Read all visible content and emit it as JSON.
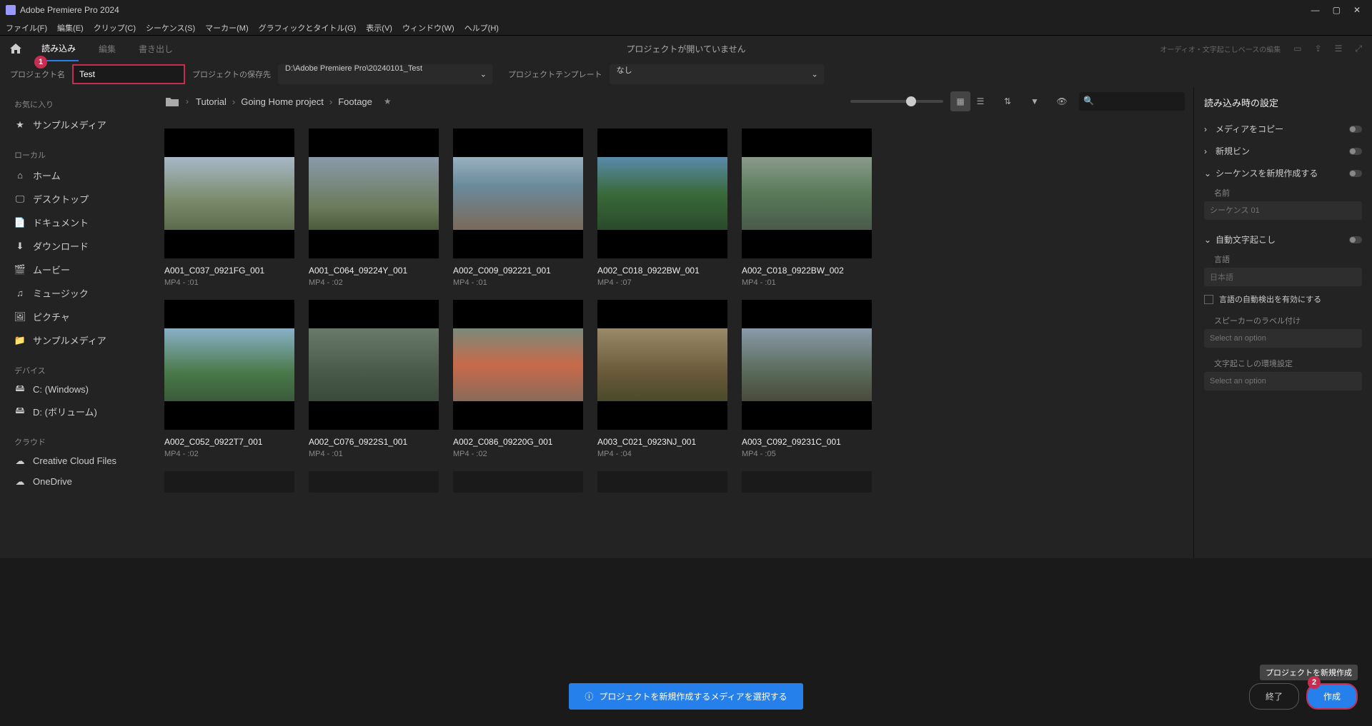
{
  "titlebar": {
    "app": "Adobe Premiere Pro 2024"
  },
  "menu": [
    "ファイル(F)",
    "編集(E)",
    "クリップ(C)",
    "シーケンス(S)",
    "マーカー(M)",
    "グラフィックとタイトル(G)",
    "表示(V)",
    "ウィンドウ(W)",
    "ヘルプ(H)"
  ],
  "tabs": {
    "import": "読み込み",
    "edit": "編集",
    "export": "書き出し"
  },
  "centerMsg": "プロジェクトが開いていません",
  "searchHint": "オーディオ・文字起こしベースの編集",
  "config": {
    "projectNameLabel": "プロジェクト名",
    "projectName": "Test",
    "locationLabel": "プロジェクトの保存先",
    "location": "D:\\Adobe Premiere Pro\\20240101_Test",
    "templateLabel": "プロジェクトテンプレート",
    "template": "なし"
  },
  "sidebar": {
    "favorites": {
      "title": "お気に入り",
      "items": [
        {
          "icon": "star",
          "label": "サンプルメディア"
        }
      ]
    },
    "local": {
      "title": "ローカル",
      "items": [
        {
          "icon": "home",
          "label": "ホーム"
        },
        {
          "icon": "desktop",
          "label": "デスクトップ"
        },
        {
          "icon": "doc",
          "label": "ドキュメント"
        },
        {
          "icon": "download",
          "label": "ダウンロード"
        },
        {
          "icon": "video",
          "label": "ムービー"
        },
        {
          "icon": "music",
          "label": "ミュージック"
        },
        {
          "icon": "picture",
          "label": "ピクチャ"
        },
        {
          "icon": "folder",
          "label": "サンプルメディア"
        }
      ]
    },
    "devices": {
      "title": "デバイス",
      "items": [
        {
          "icon": "drive",
          "label": "C: (Windows)"
        },
        {
          "icon": "drive",
          "label": "D: (ボリューム)"
        }
      ]
    },
    "cloud": {
      "title": "クラウド",
      "items": [
        {
          "icon": "cloud",
          "label": "Creative Cloud Files"
        },
        {
          "icon": "cloud",
          "label": "OneDrive"
        }
      ]
    }
  },
  "breadcrumb": [
    "Tutorial",
    "Going Home project",
    "Footage"
  ],
  "clips": [
    {
      "name": "A001_C037_0921FG_001",
      "meta": "MP4 - :01"
    },
    {
      "name": "A001_C064_09224Y_001",
      "meta": "MP4 - :02"
    },
    {
      "name": "A002_C009_092221_001",
      "meta": "MP4 - :01"
    },
    {
      "name": "A002_C018_0922BW_001",
      "meta": "MP4 - :07"
    },
    {
      "name": "A002_C018_0922BW_002",
      "meta": "MP4 - :01"
    },
    {
      "name": "A002_C052_0922T7_001",
      "meta": "MP4 - :02"
    },
    {
      "name": "A002_C076_0922S1_001",
      "meta": "MP4 - :01"
    },
    {
      "name": "A002_C086_09220G_001",
      "meta": "MP4 - :02"
    },
    {
      "name": "A003_C021_0923NJ_001",
      "meta": "MP4 - :04"
    },
    {
      "name": "A003_C092_09231C_001",
      "meta": "MP4 - :05"
    }
  ],
  "rightPanel": {
    "title": "読み込み時の設定",
    "copyMedia": "メディアをコピー",
    "newBin": "新規ビン",
    "createSeq": "シーケンスを新規作成する",
    "nameLabel": "名前",
    "seqPlaceholder": "シーケンス 01",
    "autoTranscribe": "自動文字起こし",
    "langLabel": "言語",
    "lang": "日本語",
    "autoDetect": "言語の自動検出を有効にする",
    "speakerLabel": "スピーカーのラベル付け",
    "selectOption": "Select an option",
    "prefLabel": "文字起こしの環境設定"
  },
  "footer": {
    "info": "プロジェクトを新規作成するメディアを選択する",
    "tooltip": "プロジェクトを新規作成",
    "exit": "終了",
    "create": "作成"
  },
  "callouts": {
    "one": "1",
    "two": "2"
  },
  "thumbGradients": [
    "linear-gradient(180deg,#a8b8c8 0%,#7a8a6a 60%,#5a6a4a 100%)",
    "linear-gradient(180deg,#8a9aaa 0%,#6a7a5a 70%,#4a5a3a 100%)",
    "linear-gradient(180deg,#9ab0c0 0%,#6a8a9a 40%,#7a6a5a 100%)",
    "linear-gradient(180deg,#5a8aaa 0%,#3a6a3a 50%,#2a4a2a 100%)",
    "linear-gradient(180deg,#8a9a8a 0%,#5a7a5a 50%,#4a5a4a 100%)",
    "linear-gradient(180deg,#8ab0c8 0%,#4a7a4a 60%,#3a5a3a 100%)",
    "linear-gradient(180deg,#6a7a6a 0%,#4a5a4a 60%,#3a4a3a 100%)",
    "linear-gradient(180deg,#7a8a7a 0%,#c86a4a 50%,#8a6a5a 100%)",
    "linear-gradient(180deg,#9a8a6a 0%,#6a5a3a 60%,#4a4a2a 100%)",
    "linear-gradient(180deg,#8a9aaa 0%,#5a6a5a 60%,#4a4a3a 100%)"
  ]
}
